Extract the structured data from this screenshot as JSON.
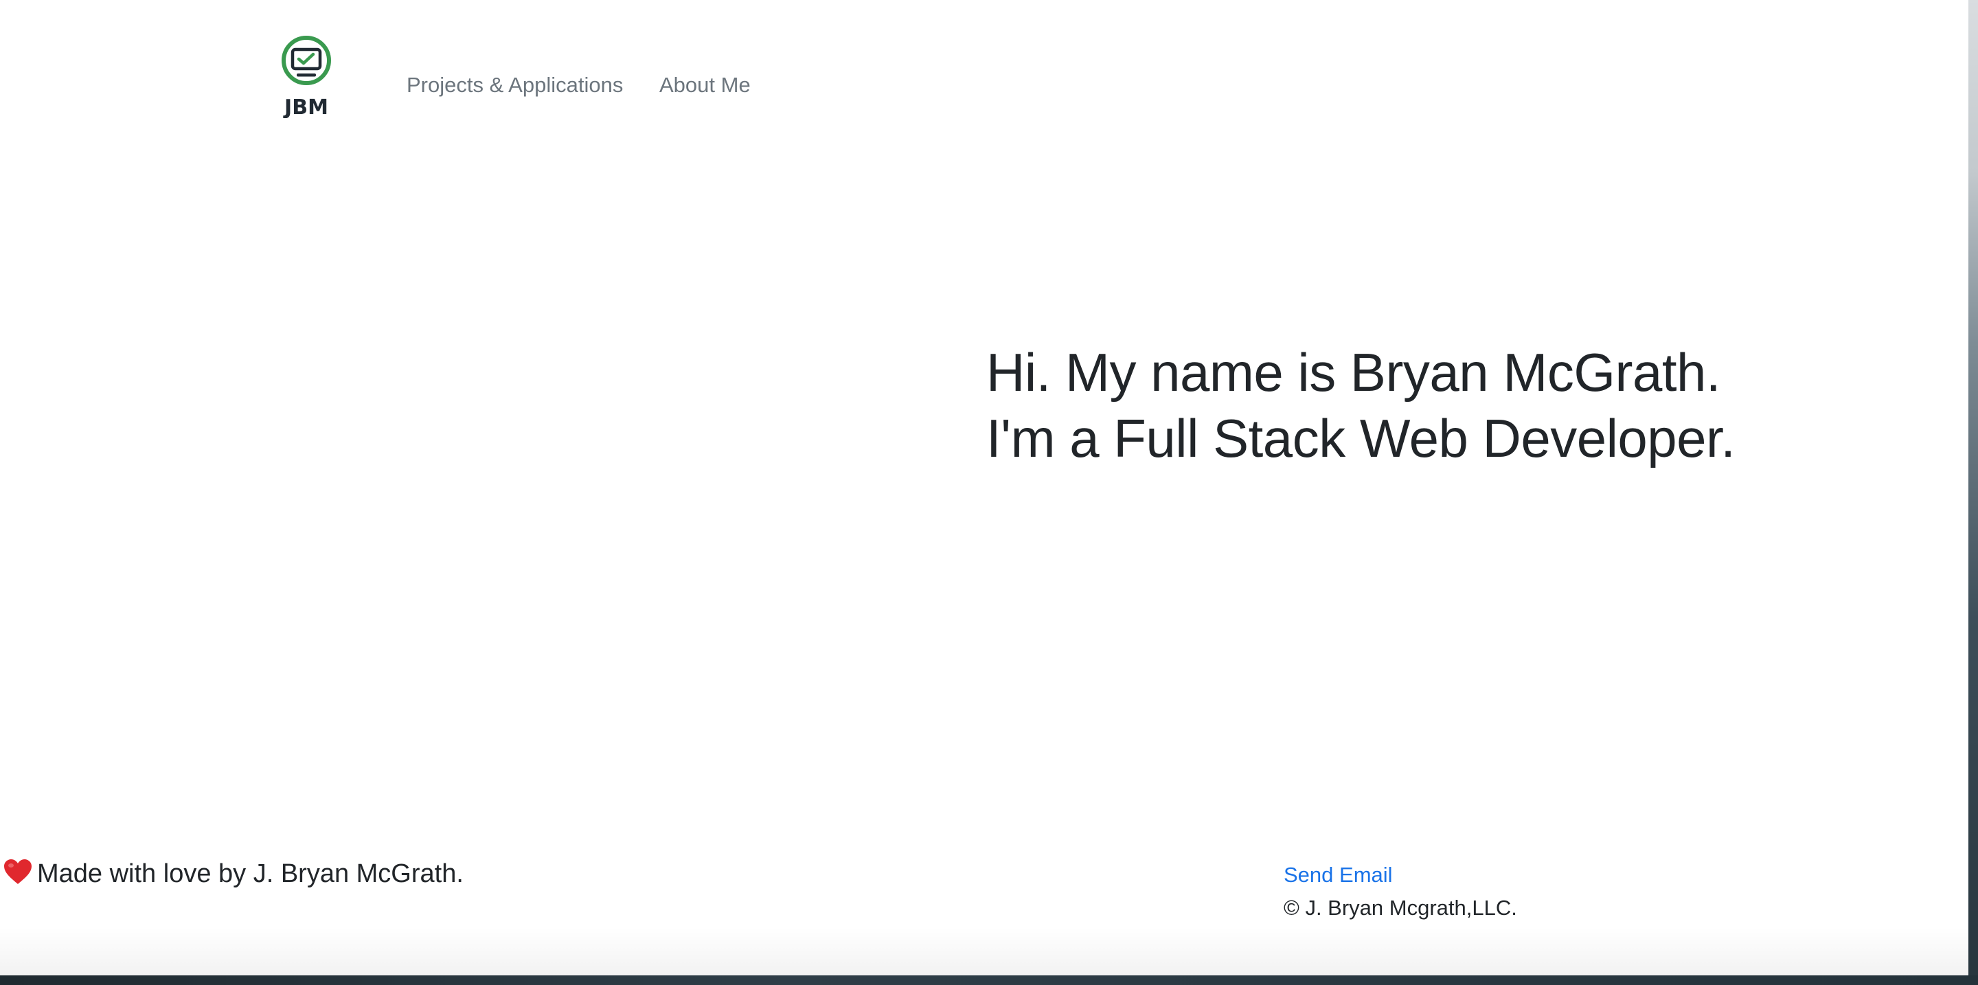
{
  "nav": {
    "brand_text": "JBM",
    "links": [
      {
        "label": "Projects & Applications"
      },
      {
        "label": "About Me"
      }
    ]
  },
  "hero": {
    "line1": "Hi. My name is Bryan McGrath.",
    "line2": "I'm a Full Stack Web Developer."
  },
  "footer": {
    "made_with_love": "Made with love by J. Bryan McGrath.",
    "send_email": "Send Email",
    "copyright": "© J. Bryan Mcgrath,LLC."
  },
  "icons": {
    "logo": "monitor-check-icon",
    "heart": "heart-icon"
  },
  "colors": {
    "logo_ring": "#3a9a4f",
    "logo_dark": "#212a33",
    "nav_link": "#6c757d",
    "text": "#212529",
    "link": "#1a73e8",
    "heart": "#e0282e"
  }
}
